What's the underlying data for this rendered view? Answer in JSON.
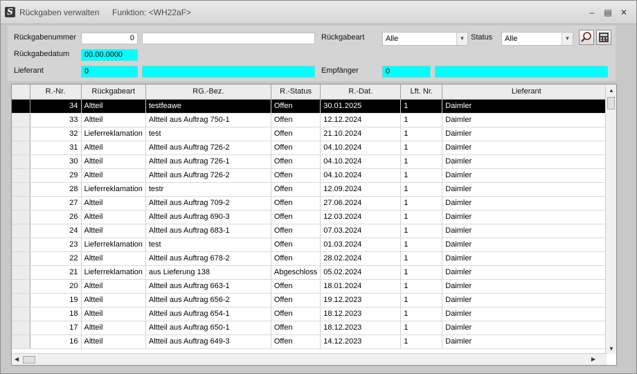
{
  "window": {
    "title": "Rückgaben verwalten",
    "function": "Funktion: <WH22aF>",
    "app_icon": "S"
  },
  "form": {
    "rueckgabenummer": {
      "label": "Rückgabenummer",
      "value": "0",
      "text": ""
    },
    "rueckgabedatum": {
      "label": "Rückgabedatum",
      "value": "00.00.0000"
    },
    "lieferant": {
      "label": "Lieferant",
      "value": "0",
      "name": ""
    },
    "rueckgabeart": {
      "label": "Rückgabeart",
      "value": "Alle"
    },
    "status": {
      "label": "Status",
      "value": "Alle"
    },
    "empfaenger": {
      "label": "Empfänger",
      "value": "0",
      "name": ""
    }
  },
  "grid": {
    "columns": [
      "R.-Nr.",
      "Rückgabeart",
      "RG.-Bez.",
      "R.-Status",
      "R.-Dat.",
      "Lft. Nr.",
      "Lieferant"
    ],
    "rows": [
      [
        "34",
        "Altteil",
        "testfeawe",
        "Offen",
        "30.01.2025",
        "1",
        "Daimler"
      ],
      [
        "33",
        "Altteil",
        "Altteil aus Auftrag 750-1",
        "Offen",
        "12.12.2024",
        "1",
        "Daimler"
      ],
      [
        "32",
        "Lieferreklamation",
        "test",
        "Offen",
        "21.10.2024",
        "1",
        "Daimler"
      ],
      [
        "31",
        "Altteil",
        "Altteil aus Auftrag 726-2",
        "Offen",
        "04.10.2024",
        "1",
        "Daimler"
      ],
      [
        "30",
        "Altteil",
        "Altteil aus Auftrag 726-1",
        "Offen",
        "04.10.2024",
        "1",
        "Daimler"
      ],
      [
        "29",
        "Altteil",
        "Altteil aus Auftrag 726-2",
        "Offen",
        "04.10.2024",
        "1",
        "Daimler"
      ],
      [
        "28",
        "Lieferreklamation",
        "testr",
        "Offen",
        "12.09.2024",
        "1",
        "Daimler"
      ],
      [
        "27",
        "Altteil",
        "Altteil aus Auftrag 709-2",
        "Offen",
        "27.06.2024",
        "1",
        "Daimler"
      ],
      [
        "26",
        "Altteil",
        "Altteil aus Auftrag 690-3",
        "Offen",
        "12.03.2024",
        "1",
        "Daimler"
      ],
      [
        "24",
        "Altteil",
        "Altteil aus Auftrag 683-1",
        "Offen",
        "07.03.2024",
        "1",
        "Daimler"
      ],
      [
        "23",
        "Lieferreklamation",
        "test",
        "Offen",
        "01.03.2024",
        "1",
        "Daimler"
      ],
      [
        "22",
        "Altteil",
        "Altteil aus Auftrag 678-2",
        "Offen",
        "28.02.2024",
        "1",
        "Daimler"
      ],
      [
        "21",
        "Lieferreklamation",
        "aus Lieferung 138",
        "Abgeschloss",
        "05.02.2024",
        "1",
        "Daimler"
      ],
      [
        "20",
        "Altteil",
        "Altteil aus Auftrag 663-1",
        "Offen",
        "18.01.2024",
        "1",
        "Daimler"
      ],
      [
        "19",
        "Altteil",
        "Altteil aus Auftrag 656-2",
        "Offen",
        "19.12.2023",
        "1",
        "Daimler"
      ],
      [
        "18",
        "Altteil",
        "Altteil aus Auftrag 654-1",
        "Offen",
        "18.12.2023",
        "1",
        "Daimler"
      ],
      [
        "17",
        "Altteil",
        "Altteil aus Auftrag 650-1",
        "Offen",
        "18.12.2023",
        "1",
        "Daimler"
      ],
      [
        "16",
        "Altteil",
        "Altteil aus Auftrag 649-3",
        "Offen",
        "14.12.2023",
        "1",
        "Daimler"
      ]
    ],
    "selected_row": 0
  },
  "icons": {
    "minimize": "minimize-icon",
    "maximize": "maximize-icon",
    "close": "close-icon",
    "search": "search-icon",
    "calculator": "calculator-icon"
  },
  "colors": {
    "cyan_field": "#00ffff",
    "selected_row": "#000000"
  }
}
